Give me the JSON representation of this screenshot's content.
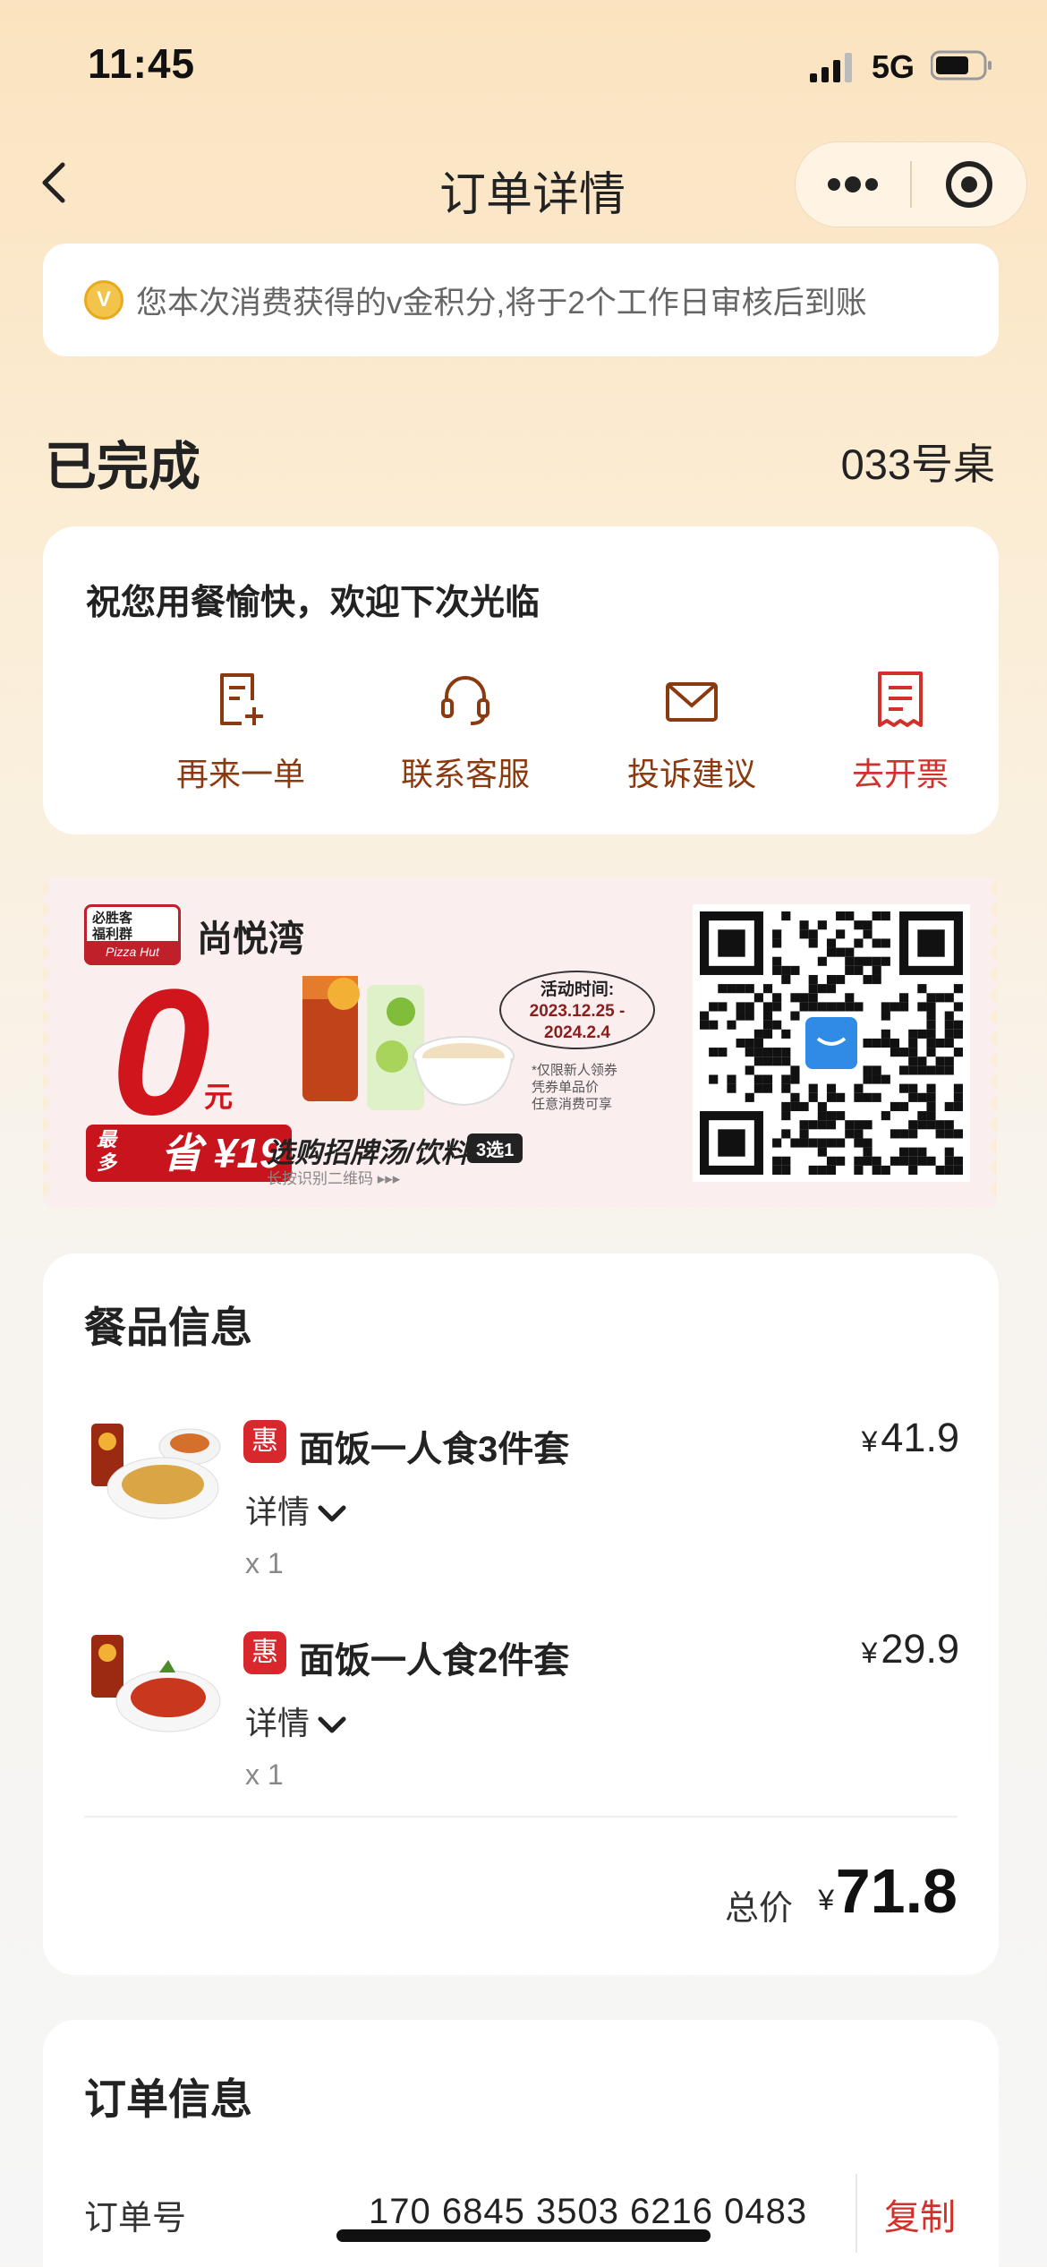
{
  "status_bar": {
    "time": "11:45",
    "network": "5G"
  },
  "nav": {
    "title": "订单详情"
  },
  "notice": {
    "coin_letter": "V",
    "text": "您本次消费获得的v金积分,将于2个工作日审核后到账"
  },
  "order_status": {
    "state": "已完成",
    "table": "033号桌"
  },
  "welcome": {
    "message": "祝您用餐愉快，欢迎下次光临",
    "actions": [
      {
        "label": "再来一单",
        "icon": "reorder-icon"
      },
      {
        "label": "联系客服",
        "icon": "headset-icon"
      },
      {
        "label": "投诉建议",
        "icon": "mail-icon"
      },
      {
        "label": "去开票",
        "icon": "invoice-icon"
      }
    ]
  },
  "promo": {
    "logo_top": "必胜客\n福利群",
    "logo_bottom": "Pizza Hut",
    "shop": "尚悦湾",
    "zero": "0",
    "yuan": "元",
    "save_small": "最\n多",
    "save_text": "省 ¥19",
    "period_title": "活动时间:",
    "period_dates": "2023.12.25 -\n2024.2.4",
    "note": "*仅限新人领券\n凭券单品价\n任意消费可享",
    "pick": "选购招牌汤/饮料",
    "pick_tag": "3选1",
    "hint": "长按识别二维码 ▸▸▸"
  },
  "items_section": {
    "title": "餐品信息",
    "items": [
      {
        "tag": "惠",
        "name": "面饭一人食3件套",
        "currency": "¥",
        "price": "41.9",
        "detail_label": "详情",
        "qty": "x 1"
      },
      {
        "tag": "惠",
        "name": "面饭一人食2件套",
        "currency": "¥",
        "price": "29.9",
        "detail_label": "详情",
        "qty": "x 1"
      }
    ],
    "total_label": "总价",
    "total_currency": "¥",
    "total": "71.8"
  },
  "order_info": {
    "title": "订单信息",
    "order_no_label": "订单号",
    "order_no": "170 6845 3503 6216 0483",
    "copy_label": "复制"
  },
  "colors": {
    "accent_red": "#d2312b",
    "brown": "#8b3a10",
    "bg_top": "#fbe3bf"
  }
}
